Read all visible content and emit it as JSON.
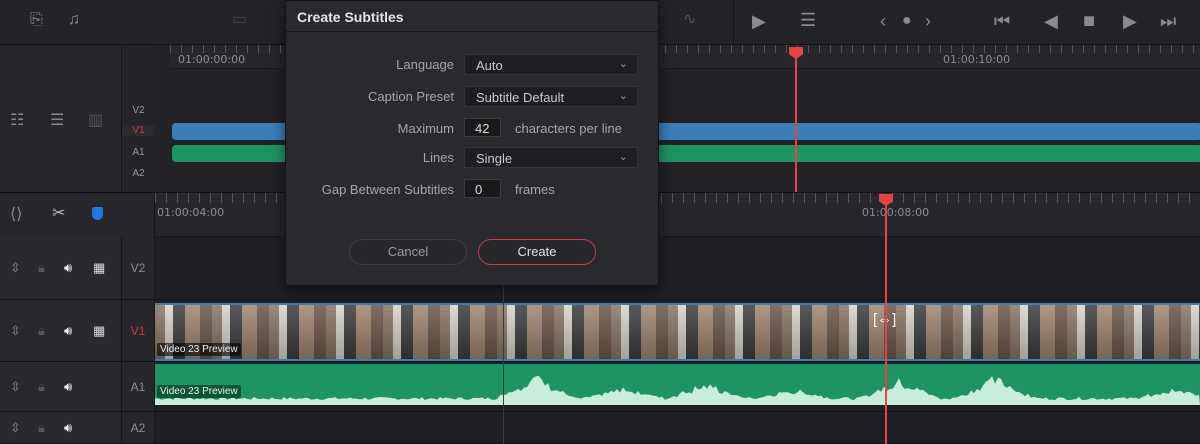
{
  "toolbar": {
    "icons": [
      "insert-clip-icon",
      "insert-audio-icon",
      "overwrite-icon",
      "audio-waveform-icon",
      "play-clip-icon",
      "mixer-settings-icon"
    ],
    "nav_prev": "‹",
    "nav_next": "›",
    "transport": [
      "jump-start",
      "reverse",
      "stop",
      "play",
      "jump-end"
    ]
  },
  "mini_timeline": {
    "timecodes": [
      "01:00:00:00",
      "01:00:10:00"
    ],
    "tracks": [
      "V2",
      "V1",
      "A1",
      "A2"
    ],
    "active_track": "V1"
  },
  "timeline": {
    "timecodes": [
      "01:00:04:00",
      "01:00:08:00"
    ],
    "tracks": [
      {
        "name": "V2",
        "type": "video"
      },
      {
        "name": "V1",
        "type": "video",
        "active": true,
        "clip": "Video 23 Preview"
      },
      {
        "name": "A1",
        "type": "audio",
        "clip": "Video 23 Preview"
      },
      {
        "name": "A2",
        "type": "audio"
      }
    ]
  },
  "dialog": {
    "title": "Create Subtitles",
    "language_label": "Language",
    "language_value": "Auto",
    "preset_label": "Caption Preset",
    "preset_value": "Subtitle Default",
    "maximum_label": "Maximum",
    "maximum_value": "42",
    "maximum_unit": "characters per line",
    "lines_label": "Lines",
    "lines_value": "Single",
    "gap_label": "Gap Between Subtitles",
    "gap_value": "0",
    "gap_unit": "frames",
    "cancel": "Cancel",
    "create": "Create"
  },
  "colors": {
    "playhead": "#e64444",
    "video_clip": "#3a7fb8",
    "audio_clip": "#1f9463",
    "active_track": "#d23a3a"
  }
}
